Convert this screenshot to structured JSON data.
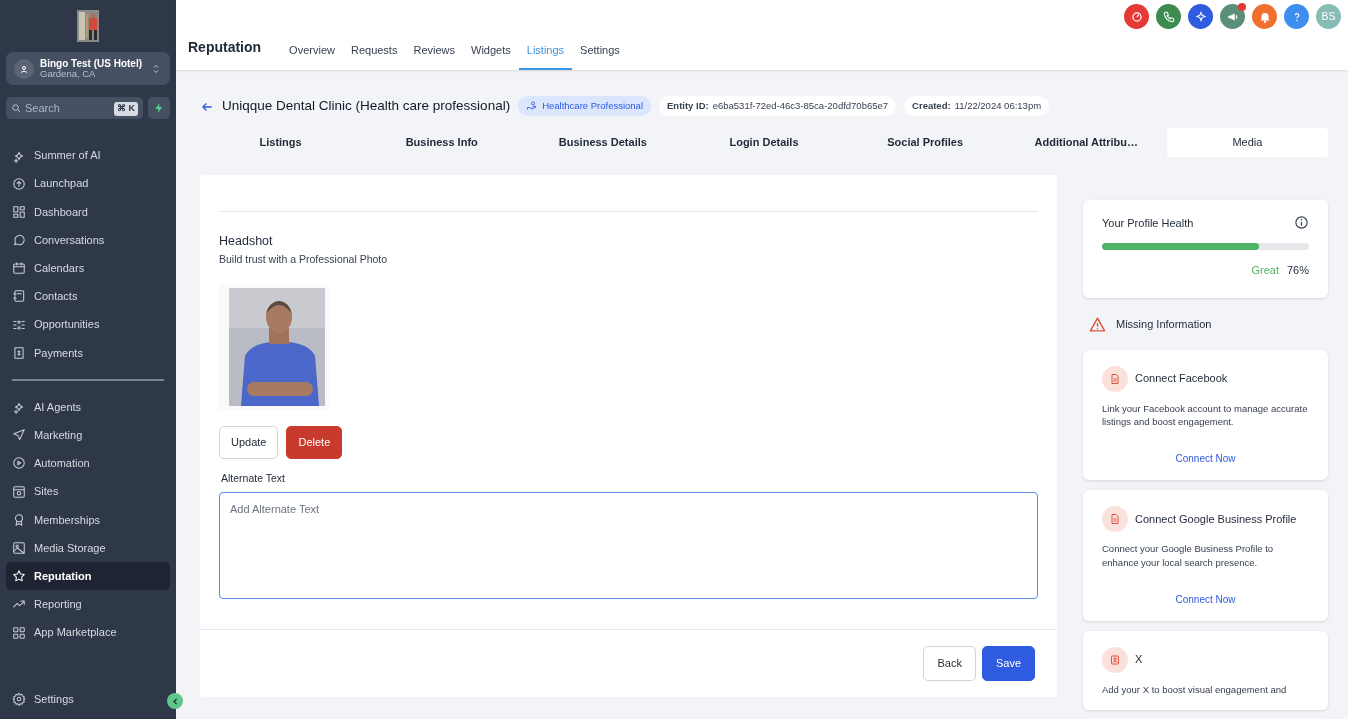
{
  "sidebar": {
    "account": {
      "name": "Bingo Test (US Hotel)",
      "location": "Gardena, CA"
    },
    "search": {
      "placeholder": "Search",
      "shortcut": "⌘ K"
    },
    "nav_groups": [
      [
        {
          "label": "Summer of AI",
          "selected": false
        },
        {
          "label": "Launchpad",
          "selected": false
        },
        {
          "label": "Dashboard",
          "selected": false
        },
        {
          "label": "Conversations",
          "selected": false
        },
        {
          "label": "Calendars",
          "selected": false
        },
        {
          "label": "Contacts",
          "selected": false
        },
        {
          "label": "Opportunities",
          "selected": false
        },
        {
          "label": "Payments",
          "selected": false
        }
      ],
      [
        {
          "label": "AI Agents",
          "selected": false
        },
        {
          "label": "Marketing",
          "selected": false
        },
        {
          "label": "Automation",
          "selected": false
        },
        {
          "label": "Sites",
          "selected": false
        },
        {
          "label": "Memberships",
          "selected": false
        },
        {
          "label": "Media Storage",
          "selected": false
        },
        {
          "label": "Reputation",
          "selected": true
        },
        {
          "label": "Reporting",
          "selected": false
        },
        {
          "label": "App Marketplace",
          "selected": false
        }
      ]
    ],
    "settings": {
      "label": "Settings"
    }
  },
  "top_actions": [
    {
      "color": "#e53935",
      "notification": false
    },
    {
      "color": "#3d8b4f",
      "notification": false
    },
    {
      "color": "#2f5be0",
      "notification": false
    },
    {
      "color": "#5b8f78",
      "notification": true
    },
    {
      "color": "#f07030",
      "notification": false
    },
    {
      "color": "#3e8ef0",
      "notification": false
    }
  ],
  "avatar": {
    "initials": "BS"
  },
  "app_title": "Reputation",
  "tabs": [
    {
      "label": "Overview",
      "selected": false
    },
    {
      "label": "Requests",
      "selected": false
    },
    {
      "label": "Reviews",
      "selected": false
    },
    {
      "label": "Widgets",
      "selected": false
    },
    {
      "label": "Listings",
      "selected": true
    },
    {
      "label": "Settings",
      "selected": false
    }
  ],
  "entity": {
    "title": "Uniqque Dental Clinic (Health care professional)",
    "category": "Healthcare Professional",
    "id_label": "Entity ID:",
    "id_value": "e6ba531f-72ed-46c3-85ca-20dfd70b65e7",
    "created_label": "Created:",
    "created_value": "11/22/2024 06:13pm"
  },
  "section_tabs": [
    {
      "label": "Listings",
      "selected": false
    },
    {
      "label": "Business Info",
      "selected": false
    },
    {
      "label": "Business Details",
      "selected": false
    },
    {
      "label": "Login Details",
      "selected": false
    },
    {
      "label": "Social Profiles",
      "selected": false
    },
    {
      "label": "Additional Attribu…",
      "selected": false
    },
    {
      "label": "Media",
      "selected": true
    }
  ],
  "headshot": {
    "title": "Headshot",
    "subtitle": "Build trust with a Professional Photo",
    "photo": {
      "kind": "picture"
    },
    "buttons": [
      "Update",
      "Delete"
    ],
    "alt_label": "Alternate Text",
    "alt_placeholder": "Add Alternate Text"
  },
  "footer_buttons": [
    "Back",
    "Save"
  ],
  "profile_health": {
    "title": "Your Profile Health",
    "level": 0.76,
    "rating": "Great",
    "percent": "76%"
  },
  "missing_title": "Missing Information",
  "missing_cards": [
    {
      "title": "Connect Facebook",
      "description": "Link your Facebook account to manage accurate listings and boost engagement.",
      "link": "Connect Now"
    },
    {
      "title": "Connect Google Business Profile",
      "description": "Connect your Google Business Profile to enhance your local search presence.",
      "link": "Connect Now"
    },
    {
      "title": "X",
      "description": "Add your X to boost visual engagement and"
    }
  ]
}
